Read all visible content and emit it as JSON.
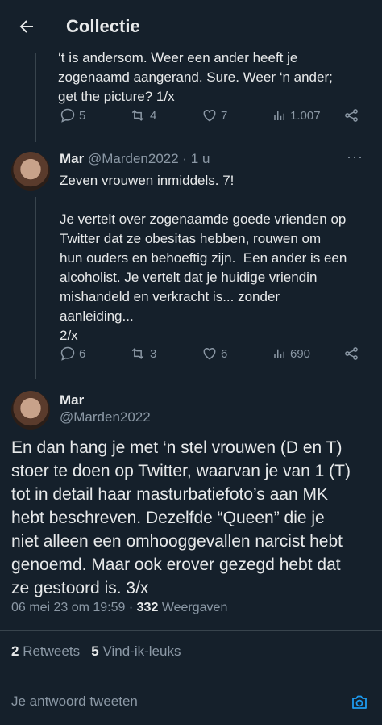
{
  "topbar": {
    "title": "Collectie"
  },
  "previous_tweet": {
    "text": "‘t is andersom. Weer een ander heeft je\nzogenaamd aangerand. Sure. Weer ‘n ander;\nget the picture? 1/x",
    "replies": "5",
    "retweets": "4",
    "likes": "7",
    "views": "1.007"
  },
  "tweet2": {
    "name": "Mar",
    "handle": "@Marden2022",
    "time": "· 1 u",
    "text": "Zeven vrouwen inmiddels. 7!\n\nJe vertelt over zogenaamde goede vrienden op\nTwitter dat ze obesitas hebben, rouwen om\nhun ouders en behoeftig zijn.  Een ander is een\nalcoholist. Je vertelt dat je huidige vriendin\nmishandeld en verkracht is... zonder\naanleiding...\n2/x",
    "replies": "6",
    "retweets": "3",
    "likes": "6",
    "views": "690"
  },
  "main_tweet": {
    "name": "Mar",
    "handle": "@Marden2022",
    "text": "En dan hang je met ‘n stel vrouwen (D en T)\nstoer te doen op Twitter, waarvan je van 1 (T)\ntot in detail haar masturbatiefoto’s aan MK\nhebt beschreven. Dezelfde “Queen” die je\nniet alleen een omhooggevallen narcist hebt\ngenoemd. Maar ook erover gezegd hebt dat\nze gestoord is. 3/x",
    "timestamp": "06 mei 23 om 19:59 ·",
    "views_count": "332",
    "views_label": "Weergaven",
    "retweets_count": "2",
    "retweets_label": "Retweets",
    "likes_count": "5",
    "likes_label": "Vind-ik-leuks"
  },
  "reply": {
    "placeholder": "Je antwoord tweeten"
  },
  "colors": {
    "background": "#15202b",
    "accent": "#1d9bf0",
    "muted": "#8b98a5"
  },
  "icons": [
    "back-arrow-icon",
    "reply-icon",
    "retweet-icon",
    "like-icon",
    "views-icon",
    "share-icon",
    "more-icon",
    "camera-icon"
  ]
}
